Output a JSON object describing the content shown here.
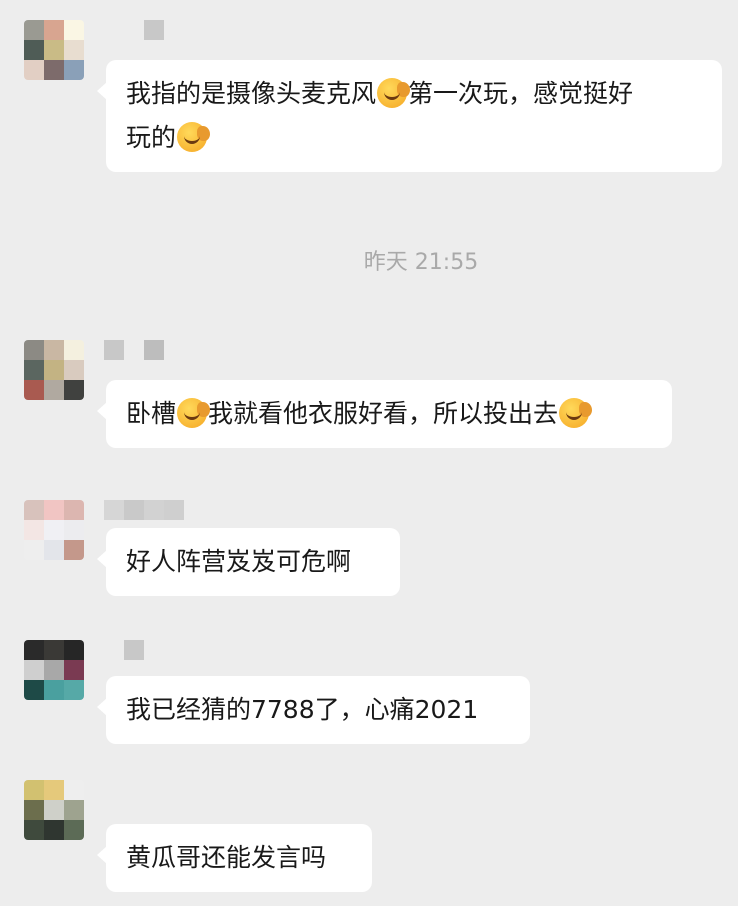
{
  "timestamp": "昨天 21:55",
  "messages": [
    {
      "avatar": [
        "#9a9a92",
        "#d8a590",
        "#faf6e4",
        "#4f5c56",
        "#c9bb86",
        "#e8ddd0",
        "#e2cfc4",
        "#7d6b6b",
        "#8aa0b8"
      ],
      "nick": [
        "#c8c8c8"
      ],
      "parts": [
        {
          "t": "text",
          "v": "我指的是摄像头麦克风"
        },
        {
          "t": "emoji",
          "v": "facepalm-laugh"
        },
        {
          "t": "text",
          "v": "第一次玩，感觉挺好"
        },
        {
          "t": "br"
        },
        {
          "t": "text",
          "v": "玩的"
        },
        {
          "t": "emoji",
          "v": "facepalm-laugh"
        }
      ]
    },
    {
      "avatar": [
        "#8c8a84",
        "#c9b7a3",
        "#f4f0df",
        "#5b6660",
        "#c3b383",
        "#d9cbbf",
        "#a95a50",
        "#b0a9a0",
        "#40413f"
      ],
      "nick": [
        "#c8c8c8",
        "#ededed",
        "#bdbdbd"
      ],
      "parts": [
        {
          "t": "text",
          "v": "卧槽"
        },
        {
          "t": "emoji",
          "v": "facepalm-laugh"
        },
        {
          "t": "text",
          "v": "我就看他衣服好看，所以投出去"
        },
        {
          "t": "emoji",
          "v": "facepalm-laugh"
        }
      ]
    },
    {
      "avatar": [
        "#d8c2bc",
        "#f1c5c3",
        "#dcb6b0",
        "#f3e6e4",
        "#f0f0f4",
        "#ececef",
        "#eeeeee",
        "#e3e5ea",
        "#c4988b"
      ],
      "nick": [
        "#d6d6d6",
        "#c9c9c9",
        "#d2d2d2",
        "#cfcfcf"
      ],
      "parts": [
        {
          "t": "text",
          "v": "好人阵营岌岌可危啊"
        }
      ]
    },
    {
      "avatar": [
        "#2a2a2a",
        "#3a3936",
        "#262626",
        "#cfcfcf",
        "#a8a8a8",
        "#7a3a52",
        "#1e4a47",
        "#4aa09f",
        "#56a9a7"
      ],
      "nick": [
        "#c8c8c8"
      ],
      "parts": [
        {
          "t": "text",
          "v": "我已经猜的7788了，心痛2021"
        }
      ]
    },
    {
      "avatar": [
        "#d2c170",
        "#e5c97b",
        "#eeeeee",
        "#6c6e4d",
        "#cfd0c9",
        "#9ea38f",
        "#3f4a3d",
        "#2f3630",
        "#5c6b56"
      ],
      "nick": [],
      "parts": [
        {
          "t": "text",
          "v": "黄瓜哥还能发言吗"
        }
      ]
    }
  ]
}
